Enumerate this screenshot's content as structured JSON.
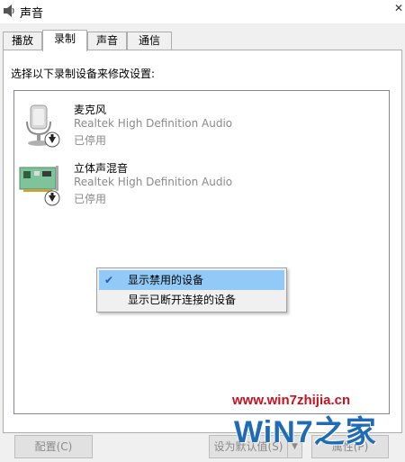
{
  "window": {
    "title": "声音"
  },
  "tabs": [
    {
      "label": "播放"
    },
    {
      "label": "录制"
    },
    {
      "label": "声音"
    },
    {
      "label": "通信"
    }
  ],
  "active_tab": "录制",
  "instruction": "选择以下录制设备来修改设置:",
  "devices": [
    {
      "name": "麦克风",
      "driver": "Realtek High Definition Audio",
      "status": "已停用",
      "icon": "microphone-icon"
    },
    {
      "name": "立体声混音",
      "driver": "Realtek High Definition Audio",
      "status": "已停用",
      "icon": "sound-card-icon"
    }
  ],
  "context_menu": {
    "items": [
      {
        "label": "显示禁用的设备",
        "checked": true,
        "highlighted": true
      },
      {
        "label": "显示已断开连接的设备",
        "checked": false,
        "highlighted": false
      }
    ]
  },
  "buttons": {
    "configure": "配置(C)",
    "set_default": "设为默认值(S)",
    "properties": "属性(P)"
  },
  "watermark": {
    "url": "www.win7zhijia.cn",
    "logo_text": "WiN7之家"
  },
  "colors": {
    "menu_highlight": "#91c9f7",
    "disabled_text": "#8a8a8a",
    "watermark_red": "#c8101f",
    "watermark_blue": "#1f6bb5"
  }
}
